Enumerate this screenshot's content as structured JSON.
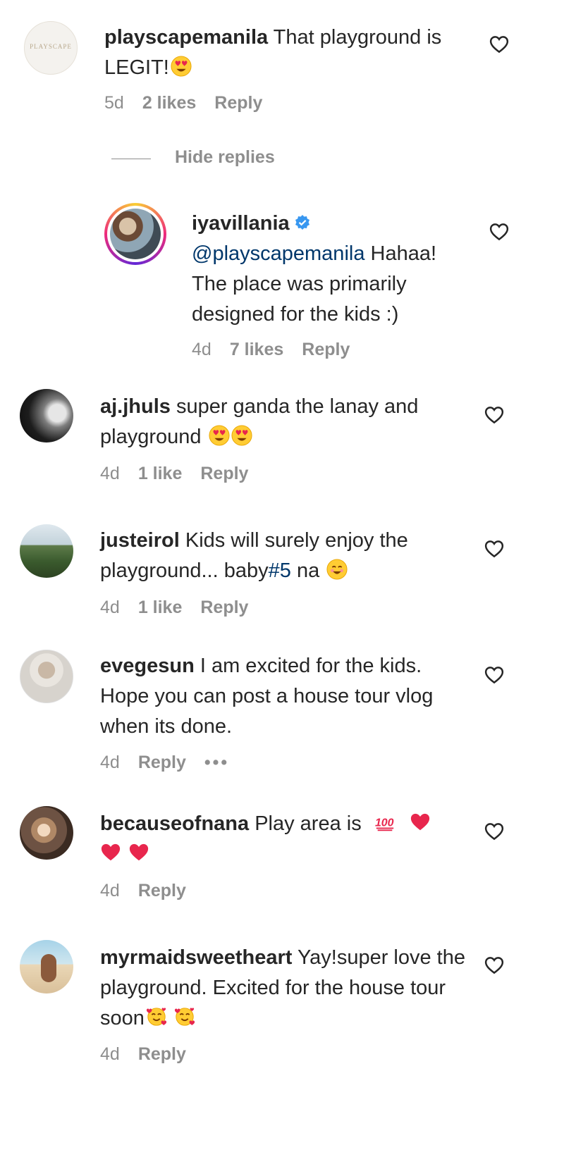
{
  "comments": [
    {
      "username": "playscapemanila",
      "text": " That playground is LEGIT!",
      "emoji": "heart-eyes",
      "age": "5d",
      "likes": "2 likes",
      "reply": "Reply",
      "avatar_text": "PLAYSCAPE"
    },
    {
      "username": "iyavillania",
      "mention": "@playscapemanila",
      "text": " Hahaa! The place was primarily designed for the kids :)",
      "age": "4d",
      "likes": "7 likes",
      "reply": "Reply",
      "verified": true
    },
    {
      "username": "aj.jhuls",
      "text": " super ganda the lanay and playground",
      "emoji": "heart-eyes x2",
      "age": "4d",
      "likes": "1 like",
      "reply": "Reply"
    },
    {
      "username": "justeirol",
      "text": " Kids will surely enjoy the playground... baby",
      "hashtag": "#5",
      "text_after": " na",
      "emoji": "smiling-face",
      "age": "4d",
      "likes": "1 like",
      "reply": "Reply"
    },
    {
      "username": "evegesun",
      "text": " I am excited for the kids. Hope you can post a house tour vlog when its done.",
      "age": "4d",
      "reply": "Reply",
      "more": "•••"
    },
    {
      "username": "becauseofnana",
      "text": " Play area is",
      "emoji": "hundred-points, red-heart x3",
      "age": "4d",
      "reply": "Reply"
    },
    {
      "username": "myrmaidsweetheart",
      "text": " Yay!super love the playground. Excited for the house tour soon",
      "emoji": "smiling-face-with-hearts x2",
      "age": "4d",
      "reply": "Reply"
    }
  ],
  "thread": {
    "hide_replies": "Hide replies"
  },
  "colors": {
    "text": "#262626",
    "meta": "#8e8e8e",
    "link": "#00376b",
    "verified": "#3897f0"
  }
}
